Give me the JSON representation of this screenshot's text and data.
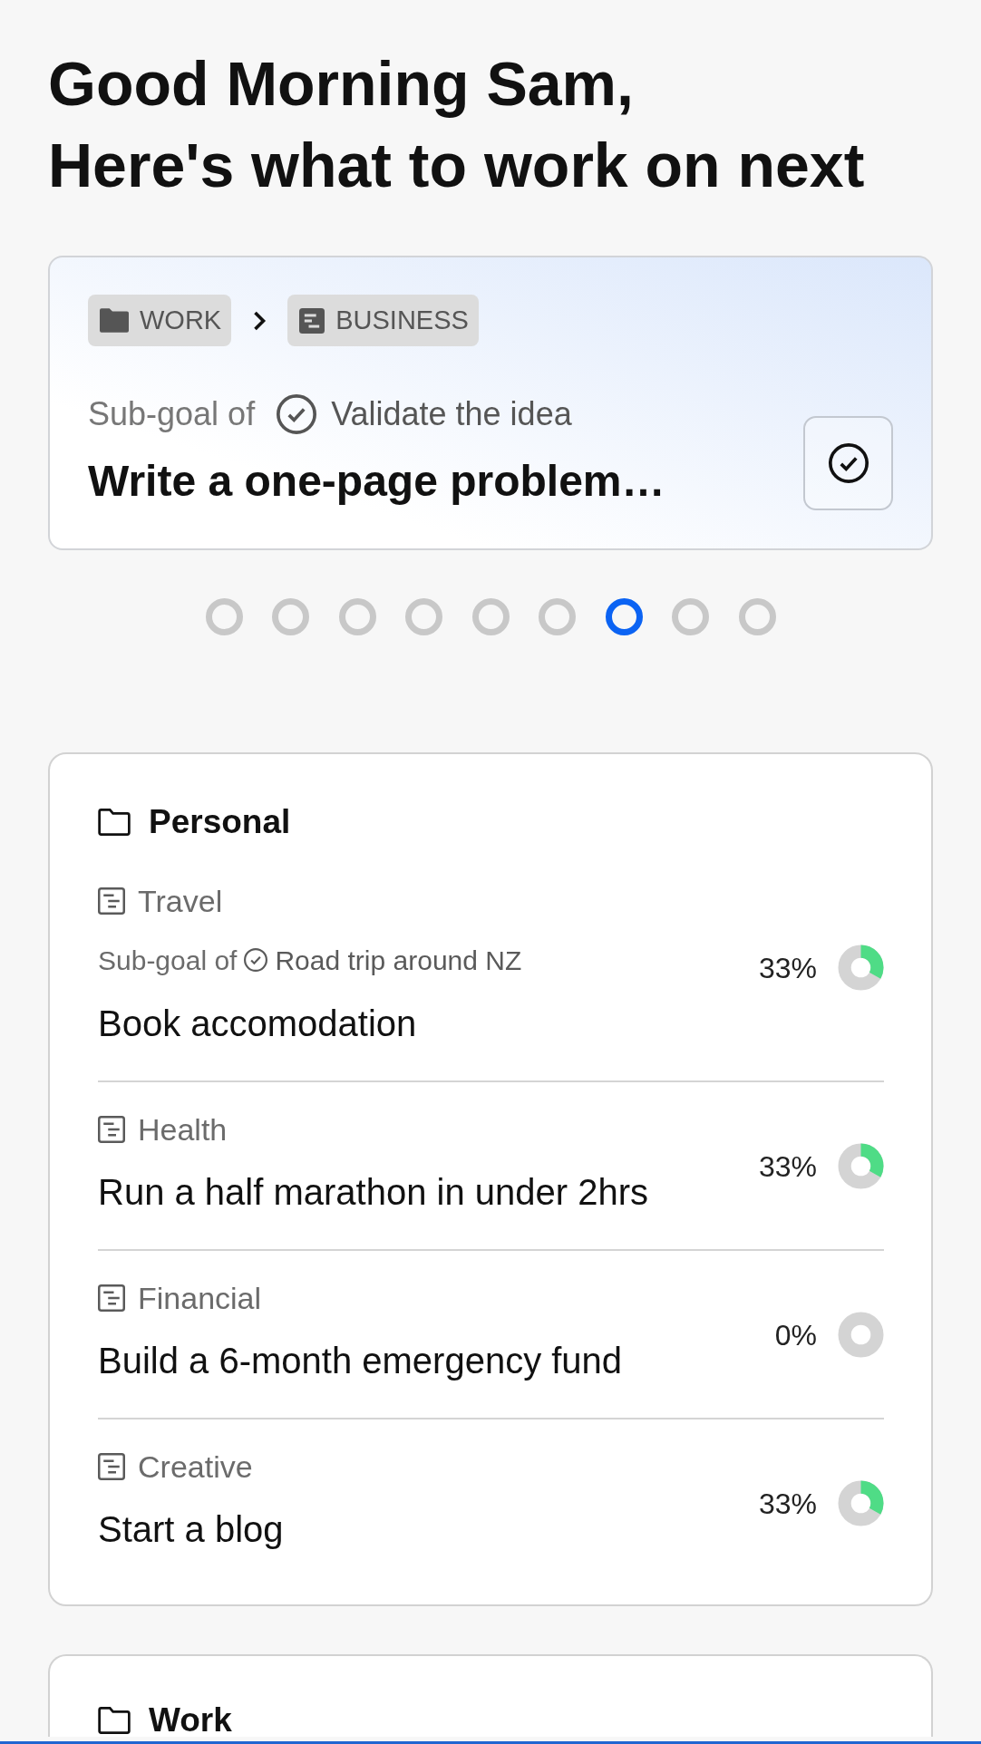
{
  "greeting": {
    "lines": [
      "Good Morning Sam,",
      "Here's what to work on next"
    ]
  },
  "focus_card": {
    "breadcrumb": [
      {
        "kind": "folder",
        "label": "WORK"
      },
      {
        "kind": "category",
        "label": "BUSINESS"
      }
    ],
    "subgoal_prefix": "Sub-goal of",
    "parent_goal": "Validate the idea",
    "title": "Write a one-page problem…"
  },
  "carousel": {
    "dots": [
      {
        "selected": false
      },
      {
        "selected": false
      },
      {
        "selected": false
      },
      {
        "selected": false
      },
      {
        "selected": false
      },
      {
        "selected": false
      },
      {
        "selected": true
      },
      {
        "selected": false
      },
      {
        "selected": false
      }
    ]
  },
  "goal_groups": [
    {
      "name": "Personal",
      "goals": [
        {
          "category": "Travel",
          "subgoal_prefix": "Sub-goal of",
          "parent_goal": "Road trip around NZ",
          "title": "Book accomodation",
          "percent": "33%",
          "level": 0.33
        },
        {
          "category": "Health",
          "title": "Run a half marathon in under 2hrs",
          "percent": "33%",
          "level": 0.33
        },
        {
          "category": "Financial",
          "title": "Build a 6-month emergency fund",
          "percent": "0%",
          "level": 0
        },
        {
          "category": "Creative",
          "title": "Start a blog",
          "percent": "33%",
          "level": 0.33
        }
      ]
    },
    {
      "name": "Work"
    }
  ]
}
